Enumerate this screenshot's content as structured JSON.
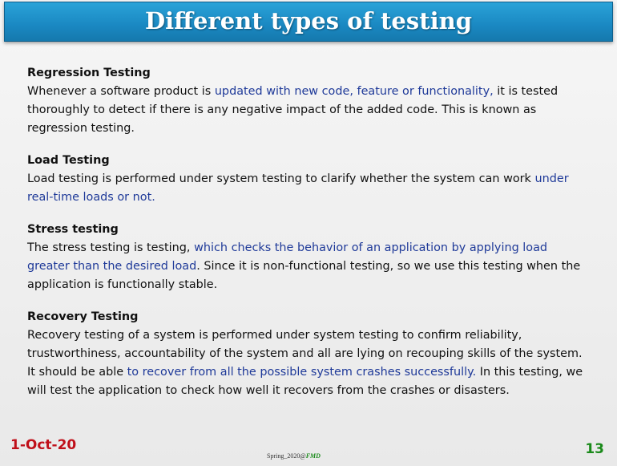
{
  "title": "Different types of testing",
  "sections": [
    {
      "heading": "Regression Testing",
      "body": [
        {
          "text": "Whenever a software product is ",
          "hl": false
        },
        {
          "text": "updated with new code, feature or functionality,",
          "hl": true
        },
        {
          "text": " it is tested thoroughly to detect if there is any negative impact of the added code. This is known as regression testing.",
          "hl": false
        }
      ]
    },
    {
      "heading": "Load Testing",
      "body": [
        {
          "text": "Load testing is performed under system testing to clarify whether the system can work ",
          "hl": false
        },
        {
          "text": "under real-time loads or not.",
          "hl": true
        }
      ]
    },
    {
      "heading": "Stress testing",
      "body": [
        {
          "text": "The stress testing is testing, ",
          "hl": false
        },
        {
          "text": "which checks the behavior of an application by applying load greater than the desired load",
          "hl": true
        },
        {
          "text": ". Since it is non-functional testing, so we use this testing when the application is functionally stable.",
          "hl": false
        }
      ]
    },
    {
      "heading": "Recovery Testing",
      "body": [
        {
          "text": "Recovery testing of a system is performed under system testing to confirm reliability, trustworthiness, accountability of the system and all are lying on recouping skills of the system. It should be able ",
          "hl": false
        },
        {
          "text": "to recover from all the possible system crashes successfully.",
          "hl": true
        },
        {
          "text": " In this testing, we will test the application to check how well it recovers from the crashes or disasters.",
          "hl": false
        }
      ]
    }
  ],
  "footer": {
    "date": "1-Oct-20",
    "center_prefix": "Spring_2020@",
    "center_brand": "FMD",
    "page_number": "13"
  },
  "colors": {
    "title_bar": "#1a88c2",
    "highlight_text": "#1f3a99",
    "date": "#c0101a",
    "page_number": "#1a8a1a"
  }
}
